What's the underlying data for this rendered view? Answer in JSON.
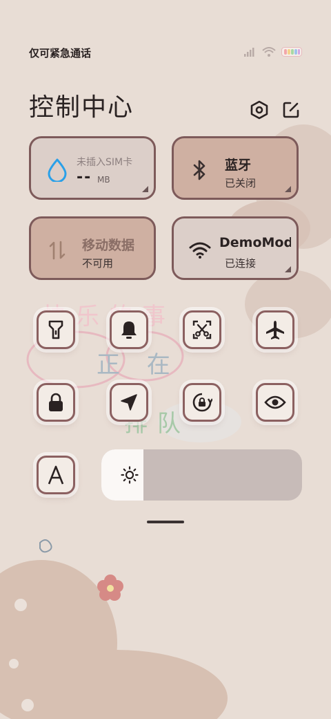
{
  "status_bar": {
    "carrier_text": "仅可紧急通话"
  },
  "header": {
    "title": "控制中心"
  },
  "tiles": {
    "data": {
      "line1": "未插入SIM卡",
      "value": "--",
      "unit": "MB"
    },
    "bluetooth": {
      "title": "蓝牙",
      "status": "已关闭"
    },
    "mobile_data": {
      "title": "移动数据",
      "status": "不可用"
    },
    "wifi": {
      "title": "DemoMod",
      "status": "已连接"
    }
  },
  "wallpaper_text": {
    "line1": "快乐的事",
    "line2": "正 在",
    "line3": "排队"
  },
  "brightness": {
    "level_percent": 21
  },
  "colors": {
    "background": "#e8ddd5",
    "accent_blue": "#2aa0e8",
    "tile_border": "#7d5a5a"
  }
}
